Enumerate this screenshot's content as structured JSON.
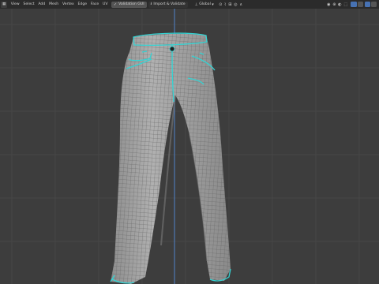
{
  "header": {
    "menus": [
      "View",
      "Select",
      "Add",
      "Mesh",
      "Vertex",
      "Edge",
      "Face",
      "UV"
    ],
    "addon_buttons": [
      {
        "icon": "validation-icon",
        "label": "Validation GUI"
      },
      {
        "icon": "import-validate-icon",
        "label": "Import & Validate"
      }
    ],
    "orientation": {
      "icon": "transform-orientation-icon",
      "label": "Global"
    }
  },
  "viewport": {
    "object": "denim-jeans-mesh",
    "mode": "edit",
    "colors": {
      "background": "#3d3d3d",
      "grid_line": "#4a4a4a",
      "y_axis": "#5182c9",
      "mesh_fill": "#9e9e9e",
      "wire": "#5f5f5f",
      "selected_edges": "#35d3d3"
    }
  }
}
